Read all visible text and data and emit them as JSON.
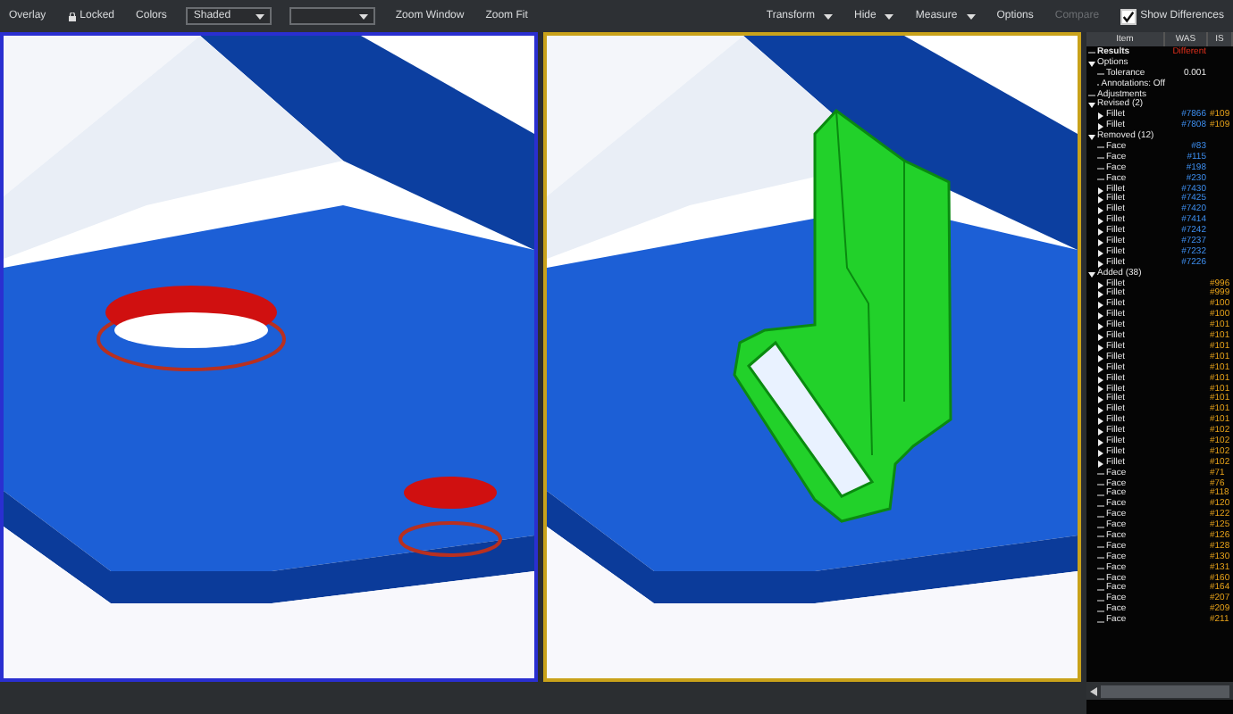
{
  "toolbar": {
    "left": [
      {
        "kind": "button",
        "label": "Overlay"
      },
      {
        "kind": "lock",
        "label": "Locked"
      },
      {
        "kind": "button",
        "label": "Colors"
      },
      {
        "kind": "select",
        "value": "Shaded"
      },
      {
        "kind": "select"
      },
      {
        "kind": "button",
        "label": "Zoom Window"
      },
      {
        "kind": "button",
        "label": "Zoom Fit"
      }
    ],
    "right": [
      {
        "kind": "menu",
        "label": "Transform"
      },
      {
        "kind": "menu",
        "label": "Hide"
      },
      {
        "kind": "menu",
        "label": "Measure"
      },
      {
        "kind": "button",
        "label": "Options"
      },
      {
        "kind": "button",
        "label": "Compare",
        "disabled": true
      },
      {
        "kind": "checkbox",
        "label": "Show Differences",
        "checked": true
      }
    ]
  },
  "viewports": [
    {
      "kind": "before",
      "selected": false
    },
    {
      "kind": "after",
      "selected": true
    }
  ],
  "panel": {
    "columns": [
      "Item",
      "WAS",
      "IS"
    ],
    "tree": [
      {
        "label": "Results",
        "was": "Different",
        "kind": "status"
      },
      {
        "label": "Options",
        "expanded": true,
        "children": [
          {
            "label": "Tolerance",
            "was": "0.001"
          },
          {
            "label": "Annotations: Off"
          }
        ]
      },
      {
        "label": "Adjustments"
      },
      {
        "label": "Revised (2)",
        "expanded": true,
        "children": [
          {
            "label": "Fillet",
            "expanded": false,
            "was": "#7866",
            "is": "#109"
          },
          {
            "label": "Fillet",
            "expanded": false,
            "was": "#7808",
            "is": "#109"
          }
        ]
      },
      {
        "label": "Removed (12)",
        "expanded": true,
        "children": [
          {
            "label": "Face",
            "was": "#83"
          },
          {
            "label": "Face",
            "was": "#115"
          },
          {
            "label": "Face",
            "was": "#198"
          },
          {
            "label": "Face",
            "was": "#230"
          },
          {
            "label": "Fillet",
            "expanded": false,
            "was": "#7430"
          },
          {
            "label": "Fillet",
            "expanded": false,
            "was": "#7425"
          },
          {
            "label": "Fillet",
            "expanded": false,
            "was": "#7420"
          },
          {
            "label": "Fillet",
            "expanded": false,
            "was": "#7414"
          },
          {
            "label": "Fillet",
            "expanded": false,
            "was": "#7242"
          },
          {
            "label": "Fillet",
            "expanded": false,
            "was": "#7237"
          },
          {
            "label": "Fillet",
            "expanded": false,
            "was": "#7232"
          },
          {
            "label": "Fillet",
            "expanded": false,
            "was": "#7226"
          }
        ]
      },
      {
        "label": "Added (38)",
        "expanded": true,
        "children": [
          {
            "label": "Fillet",
            "expanded": false,
            "is": "#996"
          },
          {
            "label": "Fillet",
            "expanded": false,
            "is": "#999"
          },
          {
            "label": "Fillet",
            "expanded": false,
            "is": "#100"
          },
          {
            "label": "Fillet",
            "expanded": false,
            "is": "#100"
          },
          {
            "label": "Fillet",
            "expanded": false,
            "is": "#101"
          },
          {
            "label": "Fillet",
            "expanded": false,
            "is": "#101"
          },
          {
            "label": "Fillet",
            "expanded": false,
            "is": "#101"
          },
          {
            "label": "Fillet",
            "expanded": false,
            "is": "#101"
          },
          {
            "label": "Fillet",
            "expanded": false,
            "is": "#101"
          },
          {
            "label": "Fillet",
            "expanded": false,
            "is": "#101"
          },
          {
            "label": "Fillet",
            "expanded": false,
            "is": "#101"
          },
          {
            "label": "Fillet",
            "expanded": false,
            "is": "#101"
          },
          {
            "label": "Fillet",
            "expanded": false,
            "is": "#101"
          },
          {
            "label": "Fillet",
            "expanded": false,
            "is": "#101"
          },
          {
            "label": "Fillet",
            "expanded": false,
            "is": "#102"
          },
          {
            "label": "Fillet",
            "expanded": false,
            "is": "#102"
          },
          {
            "label": "Fillet",
            "expanded": false,
            "is": "#102"
          },
          {
            "label": "Fillet",
            "expanded": false,
            "is": "#102"
          },
          {
            "label": "Face",
            "is": "#71"
          },
          {
            "label": "Face",
            "is": "#76"
          },
          {
            "label": "Face",
            "is": "#118"
          },
          {
            "label": "Face",
            "is": "#120"
          },
          {
            "label": "Face",
            "is": "#122"
          },
          {
            "label": "Face",
            "is": "#125"
          },
          {
            "label": "Face",
            "is": "#126"
          },
          {
            "label": "Face",
            "is": "#128"
          },
          {
            "label": "Face",
            "is": "#130"
          },
          {
            "label": "Face",
            "is": "#131"
          },
          {
            "label": "Face",
            "is": "#160"
          },
          {
            "label": "Face",
            "is": "#164"
          },
          {
            "label": "Face",
            "is": "#207"
          },
          {
            "label": "Face",
            "is": "#209"
          },
          {
            "label": "Face",
            "is": "#211"
          }
        ]
      }
    ]
  }
}
